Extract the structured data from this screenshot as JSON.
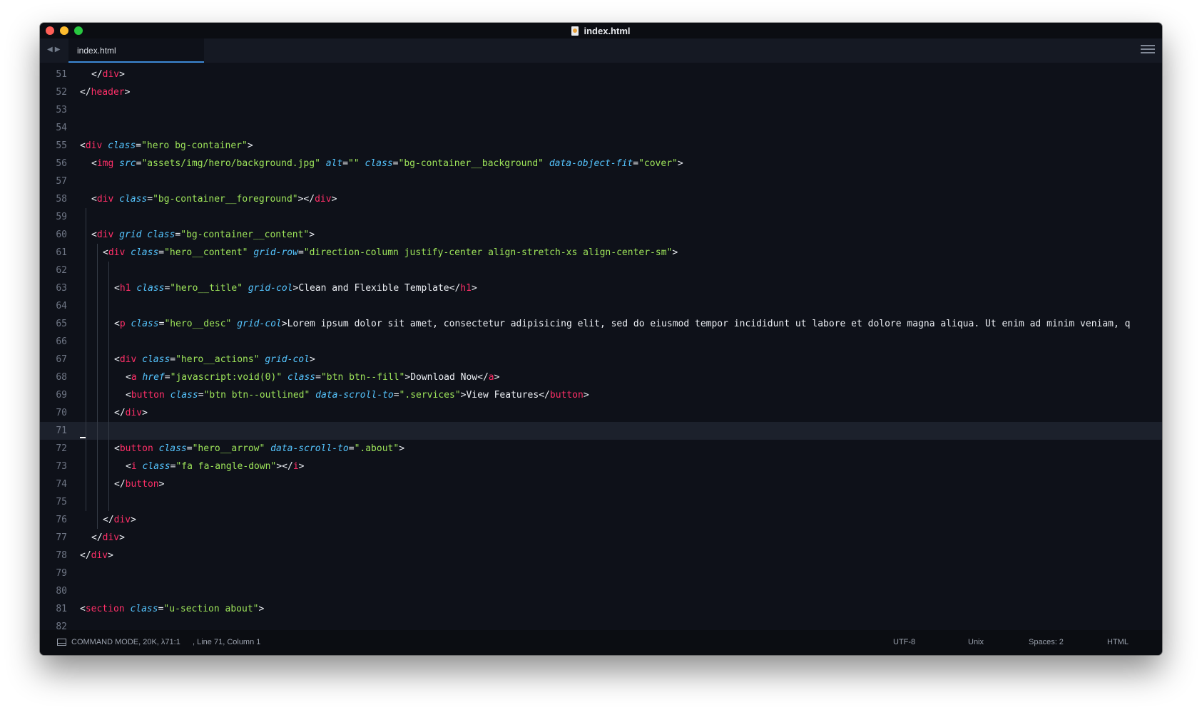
{
  "window": {
    "title": "index.html",
    "tab_label": "index.html"
  },
  "editor": {
    "current_line": 71,
    "lines": [
      {
        "n": "51",
        "tokens": [
          [
            "lt",
            "</"
          ],
          [
            "tag",
            "div"
          ],
          [
            "lt",
            ">"
          ]
        ]
      },
      {
        "n": "52",
        "tokens": [
          [
            "lt",
            "</"
          ],
          [
            "tag",
            "header"
          ],
          [
            "lt",
            ">"
          ]
        ]
      },
      {
        "n": "53",
        "tokens": []
      },
      {
        "n": "54",
        "tokens": []
      },
      {
        "n": "55",
        "tokens": [
          [
            "lt",
            "<"
          ],
          [
            "tag",
            "div"
          ],
          [
            "txt",
            " "
          ],
          [
            "attr",
            "class"
          ],
          [
            "lt",
            "="
          ],
          [
            "str",
            "\"hero bg-container\""
          ],
          [
            "lt",
            ">"
          ]
        ]
      },
      {
        "n": "56",
        "tokens": [
          [
            "lt",
            "<"
          ],
          [
            "tag",
            "img"
          ],
          [
            "txt",
            " "
          ],
          [
            "attr",
            "src"
          ],
          [
            "lt",
            "="
          ],
          [
            "str",
            "\"assets/img/hero/background.jpg\""
          ],
          [
            "txt",
            " "
          ],
          [
            "attr",
            "alt"
          ],
          [
            "lt",
            "="
          ],
          [
            "str",
            "\"\""
          ],
          [
            "txt",
            " "
          ],
          [
            "attr",
            "class"
          ],
          [
            "lt",
            "="
          ],
          [
            "str",
            "\"bg-container__background\""
          ],
          [
            "txt",
            " "
          ],
          [
            "attr",
            "data-object-fit"
          ],
          [
            "lt",
            "="
          ],
          [
            "str",
            "\"cover\""
          ],
          [
            "lt",
            ">"
          ]
        ]
      },
      {
        "n": "57",
        "tokens": []
      },
      {
        "n": "58",
        "tokens": [
          [
            "lt",
            "<"
          ],
          [
            "tag",
            "div"
          ],
          [
            "txt",
            " "
          ],
          [
            "attr",
            "class"
          ],
          [
            "lt",
            "="
          ],
          [
            "str",
            "\"bg-container__foreground\""
          ],
          [
            "lt",
            "></"
          ],
          [
            "tag",
            "div"
          ],
          [
            "lt",
            ">"
          ]
        ]
      },
      {
        "n": "59",
        "tokens": []
      },
      {
        "n": "60",
        "tokens": [
          [
            "lt",
            "<"
          ],
          [
            "tag",
            "div"
          ],
          [
            "txt",
            " "
          ],
          [
            "attr",
            "grid"
          ],
          [
            "txt",
            " "
          ],
          [
            "attr",
            "class"
          ],
          [
            "lt",
            "="
          ],
          [
            "str",
            "\"bg-container__content\""
          ],
          [
            "lt",
            ">"
          ]
        ]
      },
      {
        "n": "61",
        "tokens": [
          [
            "lt",
            "<"
          ],
          [
            "tag",
            "div"
          ],
          [
            "txt",
            " "
          ],
          [
            "attr",
            "class"
          ],
          [
            "lt",
            "="
          ],
          [
            "str",
            "\"hero__content\""
          ],
          [
            "txt",
            " "
          ],
          [
            "attr",
            "grid-row"
          ],
          [
            "lt",
            "="
          ],
          [
            "str",
            "\"direction-column justify-center align-stretch-xs align-center-sm\""
          ],
          [
            "lt",
            ">"
          ]
        ]
      },
      {
        "n": "62",
        "tokens": []
      },
      {
        "n": "63",
        "tokens": [
          [
            "lt",
            "<"
          ],
          [
            "tag",
            "h1"
          ],
          [
            "txt",
            " "
          ],
          [
            "attr",
            "class"
          ],
          [
            "lt",
            "="
          ],
          [
            "str",
            "\"hero__title\""
          ],
          [
            "txt",
            " "
          ],
          [
            "attr",
            "grid-col"
          ],
          [
            "lt",
            ">"
          ],
          [
            "txt",
            "Clean and Flexible Template"
          ],
          [
            "lt",
            "</"
          ],
          [
            "tag",
            "h1"
          ],
          [
            "lt",
            ">"
          ]
        ]
      },
      {
        "n": "64",
        "tokens": []
      },
      {
        "n": "65",
        "tokens": [
          [
            "lt",
            "<"
          ],
          [
            "tag",
            "p"
          ],
          [
            "txt",
            " "
          ],
          [
            "attr",
            "class"
          ],
          [
            "lt",
            "="
          ],
          [
            "str",
            "\"hero__desc\""
          ],
          [
            "txt",
            " "
          ],
          [
            "attr",
            "grid-col"
          ],
          [
            "lt",
            ">"
          ],
          [
            "txt",
            "Lorem ipsum dolor sit amet, consectetur adipisicing elit, sed do eiusmod tempor incididunt ut labore et dolore magna aliqua. Ut enim ad minim veniam, q"
          ]
        ]
      },
      {
        "n": "66",
        "tokens": []
      },
      {
        "n": "67",
        "tokens": [
          [
            "lt",
            "<"
          ],
          [
            "tag",
            "div"
          ],
          [
            "txt",
            " "
          ],
          [
            "attr",
            "class"
          ],
          [
            "lt",
            "="
          ],
          [
            "str",
            "\"hero__actions\""
          ],
          [
            "txt",
            " "
          ],
          [
            "attr",
            "grid-col"
          ],
          [
            "lt",
            ">"
          ]
        ]
      },
      {
        "n": "68",
        "tokens": [
          [
            "lt",
            "<"
          ],
          [
            "tag",
            "a"
          ],
          [
            "txt",
            " "
          ],
          [
            "attr",
            "href"
          ],
          [
            "lt",
            "="
          ],
          [
            "str",
            "\"javascript:void(0)\""
          ],
          [
            "txt",
            " "
          ],
          [
            "attr",
            "class"
          ],
          [
            "lt",
            "="
          ],
          [
            "str",
            "\"btn btn--fill\""
          ],
          [
            "lt",
            ">"
          ],
          [
            "txt",
            "Download Now"
          ],
          [
            "lt",
            "</"
          ],
          [
            "tag",
            "a"
          ],
          [
            "lt",
            ">"
          ]
        ]
      },
      {
        "n": "69",
        "tokens": [
          [
            "lt",
            "<"
          ],
          [
            "tag",
            "button"
          ],
          [
            "txt",
            " "
          ],
          [
            "attr",
            "class"
          ],
          [
            "lt",
            "="
          ],
          [
            "str",
            "\"btn btn--outlined\""
          ],
          [
            "txt",
            " "
          ],
          [
            "attr",
            "data-scroll-to"
          ],
          [
            "lt",
            "="
          ],
          [
            "str",
            "\".services\""
          ],
          [
            "lt",
            ">"
          ],
          [
            "txt",
            "View Features"
          ],
          [
            "lt",
            "</"
          ],
          [
            "tag",
            "button"
          ],
          [
            "lt",
            ">"
          ]
        ]
      },
      {
        "n": "70",
        "tokens": [
          [
            "lt",
            "</"
          ],
          [
            "tag",
            "div"
          ],
          [
            "lt",
            ">"
          ]
        ]
      },
      {
        "n": "71",
        "tokens": []
      },
      {
        "n": "72",
        "tokens": [
          [
            "lt",
            "<"
          ],
          [
            "tag",
            "button"
          ],
          [
            "txt",
            " "
          ],
          [
            "attr",
            "class"
          ],
          [
            "lt",
            "="
          ],
          [
            "str",
            "\"hero__arrow\""
          ],
          [
            "txt",
            " "
          ],
          [
            "attr",
            "data-scroll-to"
          ],
          [
            "lt",
            "="
          ],
          [
            "str",
            "\".about\""
          ],
          [
            "lt",
            ">"
          ]
        ]
      },
      {
        "n": "73",
        "tokens": [
          [
            "lt",
            "<"
          ],
          [
            "tag",
            "i"
          ],
          [
            "txt",
            " "
          ],
          [
            "attr",
            "class"
          ],
          [
            "lt",
            "="
          ],
          [
            "str",
            "\"fa fa-angle-down\""
          ],
          [
            "lt",
            "></"
          ],
          [
            "tag",
            "i"
          ],
          [
            "lt",
            ">"
          ]
        ]
      },
      {
        "n": "74",
        "tokens": [
          [
            "lt",
            "</"
          ],
          [
            "tag",
            "button"
          ],
          [
            "lt",
            ">"
          ]
        ]
      },
      {
        "n": "75",
        "tokens": []
      },
      {
        "n": "76",
        "tokens": [
          [
            "lt",
            "</"
          ],
          [
            "tag",
            "div"
          ],
          [
            "lt",
            ">"
          ]
        ]
      },
      {
        "n": "77",
        "tokens": [
          [
            "lt",
            "</"
          ],
          [
            "tag",
            "div"
          ],
          [
            "lt",
            ">"
          ]
        ]
      },
      {
        "n": "78",
        "tokens": [
          [
            "lt",
            "</"
          ],
          [
            "tag",
            "div"
          ],
          [
            "lt",
            ">"
          ]
        ]
      },
      {
        "n": "79",
        "tokens": []
      },
      {
        "n": "80",
        "tokens": []
      },
      {
        "n": "81",
        "tokens": [
          [
            "lt",
            "<"
          ],
          [
            "tag",
            "section"
          ],
          [
            "txt",
            " "
          ],
          [
            "attr",
            "class"
          ],
          [
            "lt",
            "="
          ],
          [
            "str",
            "\"u-section about\""
          ],
          [
            "lt",
            ">"
          ]
        ]
      },
      {
        "n": "82",
        "tokens": []
      }
    ]
  },
  "status": {
    "mode": "COMMAND MODE, 20K, λ71:1",
    "position": ", Line 71, Column 1",
    "encoding": "UTF-8",
    "line_endings": "Unix",
    "indentation": "Spaces: 2",
    "syntax": "HTML"
  },
  "colors": {
    "background": "#0e1119",
    "tag": "#ff2f68",
    "attribute": "#55c5ff",
    "string": "#9ee55a",
    "text": "#eceff4"
  }
}
